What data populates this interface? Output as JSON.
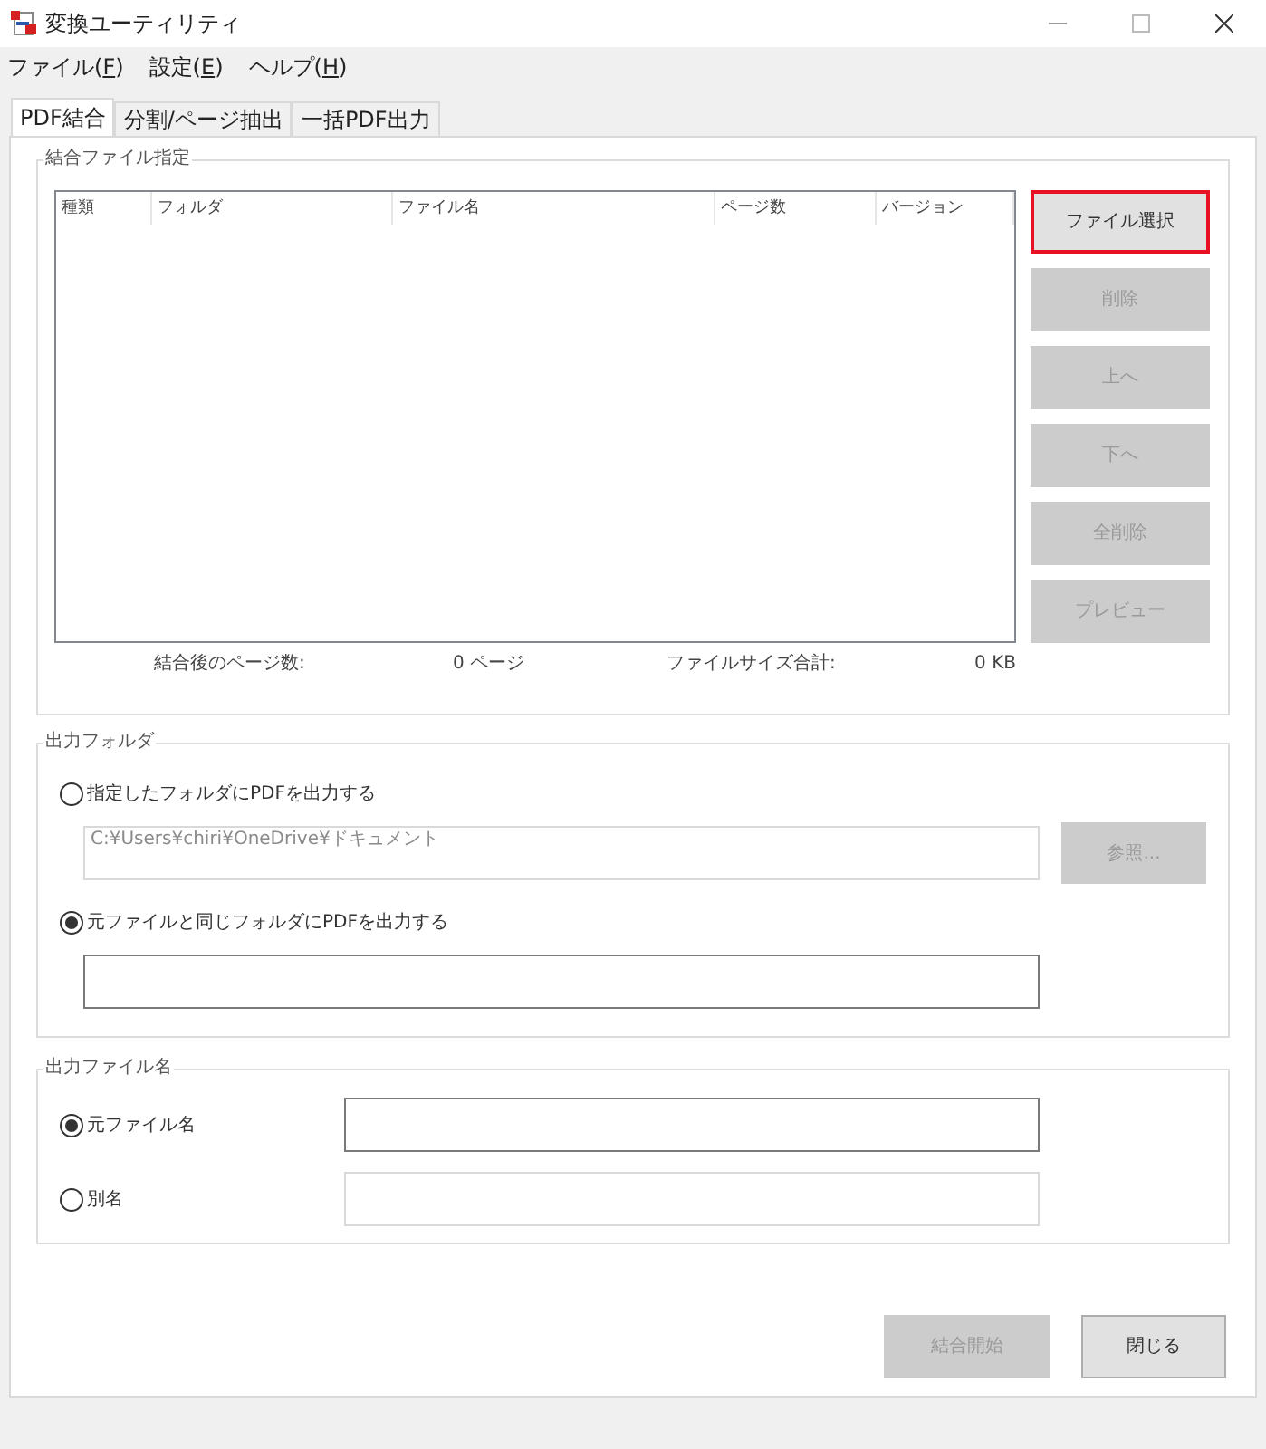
{
  "window": {
    "title": "変換ユーティリティ"
  },
  "menu": [
    {
      "label": "ファイル(",
      "key": "F",
      "end": ")"
    },
    {
      "label": "設定(",
      "key": "E",
      "end": ")"
    },
    {
      "label": "ヘルプ(",
      "key": "H",
      "end": ")"
    }
  ],
  "tabs": [
    {
      "label": "PDF結合",
      "selected": true
    },
    {
      "label": "分割/ページ抽出",
      "selected": false
    },
    {
      "label": "一括PDF出力",
      "selected": false
    }
  ],
  "merge_group": {
    "title": "結合ファイル指定",
    "columns": [
      "種類",
      "フォルダ",
      "ファイル名",
      "ページ数",
      "バージョン"
    ],
    "buttons": [
      {
        "label": "ファイル選択",
        "disabled": false,
        "focused": true
      },
      {
        "label": "削除",
        "disabled": true,
        "focused": false
      },
      {
        "label": "上へ",
        "disabled": true,
        "focused": false
      },
      {
        "label": "下へ",
        "disabled": true,
        "focused": false
      },
      {
        "label": "全削除",
        "disabled": true,
        "focused": false
      },
      {
        "label": "プレビュー",
        "disabled": true,
        "focused": false
      }
    ],
    "summary": [
      {
        "label": "結合後のページ数:",
        "value": "0 ページ"
      },
      {
        "label": "ファイルサイズ合計:",
        "value": "0 KB"
      }
    ]
  },
  "output_folder": {
    "title": "出力フォルダ",
    "options": [
      {
        "label": "指定したフォルダにPDFを出力する",
        "selected": false,
        "field": {
          "value": "C:¥Users¥chiri¥OneDrive¥ドキュメント",
          "disabled": true
        },
        "button": {
          "label": "参照...",
          "disabled": true
        }
      },
      {
        "label": "元ファイルと同じフォルダにPDFを出力する",
        "selected": true,
        "field": {
          "disabled": false
        }
      }
    ]
  },
  "output_filename": {
    "title": "出力ファイル名",
    "options": [
      {
        "label": "元ファイル名",
        "selected": true,
        "field": {
          "disabled": false
        }
      },
      {
        "label": "別名",
        "selected": false,
        "field": {
          "disabled": true
        }
      }
    ]
  },
  "footer_buttons": [
    {
      "label": "結合開始",
      "disabled": true
    },
    {
      "label": "閉じる",
      "disabled": false
    }
  ]
}
